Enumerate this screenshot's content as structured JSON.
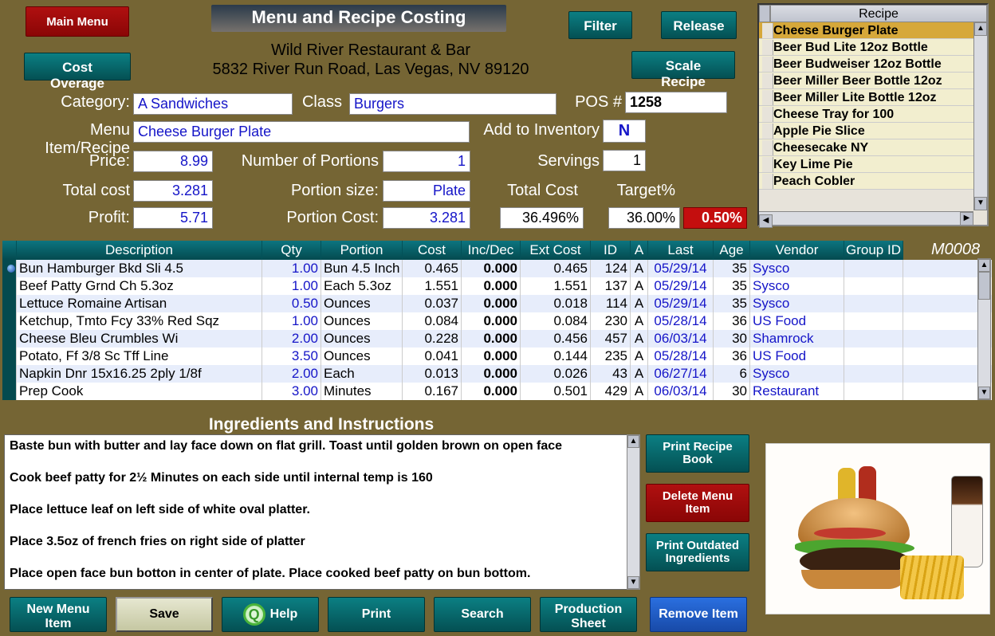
{
  "header": {
    "main_menu": "Main Menu",
    "cost_overage": "Cost Overage",
    "title": "Menu  and  Recipe  Costing",
    "restaurant": "Wild River Restaurant & Bar",
    "address": "5832 River Run Road, Las Vegas, NV 89120",
    "filter": "Filter",
    "release": "Release",
    "scale": "Scale Recipe"
  },
  "form": {
    "category_label": "Category:",
    "category": "A Sandwiches",
    "class_label": "Class",
    "class": "Burgers",
    "pos_label": "POS #",
    "pos": "1258",
    "item_label": "Menu Item/Recipe",
    "item": "Cheese Burger Plate",
    "addinv_label": "Add to Inventory",
    "addinv": "N",
    "price_label": "Price:",
    "price": "8.99",
    "num_portions_label": "Number of Portions",
    "num_portions": "1",
    "servings_label": "Servings",
    "servings": "1",
    "totalcost_label": "Total cost",
    "totalcost": "3.281",
    "portion_size_label": "Portion size:",
    "portion_size": "Plate",
    "totalcost2_label": "Total Cost",
    "target_label": "Target%",
    "profit_label": "Profit:",
    "profit": "5.71",
    "portion_cost_label": "Portion Cost:",
    "portion_cost": "3.281",
    "pct1": "36.496%",
    "pct2": "36.00%",
    "pct3": "0.50%"
  },
  "recipe_list": {
    "header": "Recipe",
    "items": [
      "Cheese Burger Plate",
      "Beer Bud Lite 12oz Bottle",
      "Beer Budweiser 12oz Bottle",
      "Beer Miller Beer Bottle 12oz",
      "Beer Miller Lite Bottle 12oz",
      "Cheese  Tray for 100",
      "Apple Pie Slice",
      "Cheesecake NY",
      "Key Lime Pie",
      "Peach Cobler"
    ]
  },
  "mcode": "M0008",
  "ing": {
    "cols": [
      "Description",
      "Qty",
      "Portion",
      "Cost",
      "Inc/Dec",
      "Ext Cost",
      "ID",
      "A",
      "Last",
      "Age",
      "Vendor",
      "Group ID"
    ],
    "rows": [
      {
        "desc": "Bun Hamburger Bkd Sli 4.5",
        "qty": "1.00",
        "port": "Bun 4.5 Inch",
        "cost": "0.465",
        "inc": "0.000",
        "ext": "0.465",
        "id": "124",
        "a": "A",
        "last": "05/29/14",
        "age": "35",
        "vend": "Sysco",
        "grp": ""
      },
      {
        "desc": "Beef Patty Grnd Ch 5.3oz",
        "qty": "1.00",
        "port": "Each 5.3oz",
        "cost": "1.551",
        "inc": "0.000",
        "ext": "1.551",
        "id": "137",
        "a": "A",
        "last": "05/29/14",
        "age": "35",
        "vend": "Sysco",
        "grp": ""
      },
      {
        "desc": "Lettuce Romaine Artisan",
        "qty": "0.50",
        "port": "Ounces",
        "cost": "0.037",
        "inc": "0.000",
        "ext": "0.018",
        "id": "114",
        "a": "A",
        "last": "05/29/14",
        "age": "35",
        "vend": "Sysco",
        "grp": ""
      },
      {
        "desc": "Ketchup, Tmto Fcy 33% Red Sqz",
        "qty": "1.00",
        "port": "Ounces",
        "cost": "0.084",
        "inc": "0.000",
        "ext": "0.084",
        "id": "230",
        "a": "A",
        "last": "05/28/14",
        "age": "36",
        "vend": "US Food",
        "grp": ""
      },
      {
        "desc": "Cheese Bleu Crumbles Wi",
        "qty": "2.00",
        "port": "Ounces",
        "cost": "0.228",
        "inc": "0.000",
        "ext": "0.456",
        "id": "457",
        "a": "A",
        "last": "06/03/14",
        "age": "30",
        "vend": "Shamrock",
        "grp": ""
      },
      {
        "desc": "Potato, Ff 3/8 Sc Tff Line",
        "qty": "3.50",
        "port": "Ounces",
        "cost": "0.041",
        "inc": "0.000",
        "ext": "0.144",
        "id": "235",
        "a": "A",
        "last": "05/28/14",
        "age": "36",
        "vend": "US Food",
        "grp": ""
      },
      {
        "desc": "Napkin Dnr 15x16.25 2ply 1/8f",
        "qty": "2.00",
        "port": "Each",
        "cost": "0.013",
        "inc": "0.000",
        "ext": "0.026",
        "id": "43",
        "a": "A",
        "last": "06/27/14",
        "age": "6",
        "vend": "Sysco",
        "grp": ""
      },
      {
        "desc": "Prep Cook",
        "qty": "3.00",
        "port": "Minutes",
        "cost": "0.167",
        "inc": "0.000",
        "ext": "0.501",
        "id": "429",
        "a": "A",
        "last": "06/03/14",
        "age": "30",
        "vend": "Restaurant",
        "grp": ""
      }
    ]
  },
  "instr": {
    "title": "Ingredients and Instructions",
    "lines": [
      "Baste bun with butter and lay face down on flat grill. Toast until golden brown on open face",
      "",
      "Cook beef patty for 2½ Minutes on each side until internal temp is 160",
      "",
      "Place lettuce leaf on left side of white oval platter.",
      "",
      "Place 3.5oz of french fries on right side of platter",
      "",
      "Place open face bun botton in center of plate. Place cooked beef patty on bun bottom."
    ]
  },
  "rbuttons": {
    "print_book": "Print Recipe Book",
    "delete": "Delete  Menu Item",
    "print_outdated": "Print Outdated Ingredients"
  },
  "bottom": {
    "new": "New Menu Item",
    "save": "Save",
    "help": "Help",
    "print": "Print",
    "search": "Search",
    "prod": "Production Sheet",
    "remove": "Remove Item"
  }
}
